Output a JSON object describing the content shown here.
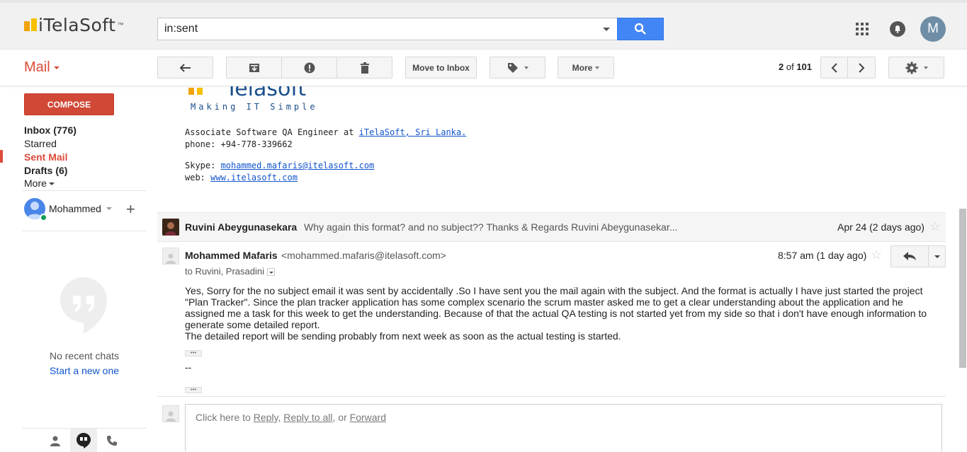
{
  "brand": {
    "name": "iTelaSoft",
    "tm": "™"
  },
  "search": {
    "query": "in:sent"
  },
  "header": {
    "avatar_letter": "M"
  },
  "toolbar": {
    "mail_label": "Mail",
    "move_to_inbox": "Move to Inbox",
    "more": "More",
    "page_current": "2",
    "page_of": "of",
    "page_total": "101"
  },
  "sidebar": {
    "compose": "COMPOSE",
    "items": [
      {
        "label": "Inbox (776)"
      },
      {
        "label": "Starred"
      },
      {
        "label": "Sent Mail"
      },
      {
        "label": "Drafts (6)"
      },
      {
        "label": "More"
      }
    ],
    "user_name": "Mohammed",
    "no_chats": "No recent chats",
    "start_new": "Start a new one"
  },
  "signature": {
    "logo_text": "Telasoft",
    "tagline": "Making IT Simple",
    "role_prefix": "Associate Software QA Engineer at ",
    "role_link": "iTelaSoft, Sri Lanka.",
    "phone": "phone: +94-778-339662",
    "skype_label": "Skype: ",
    "skype_link": "mohammed.mafaris@itelasoft.com",
    "web_label": "web: ",
    "web_link": "www.itelasoft.com"
  },
  "collapsed_message": {
    "sender": "Ruvini Abeygunasekara",
    "snippet": "Why again this format? and no subject?? Thanks & Regards Ruvini Abeygunasekar...",
    "date": "Apr 24 (2 days ago)"
  },
  "message": {
    "from_name": "Mohammed Mafaris",
    "from_email": "<mohammed.mafaris@itelasoft.com>",
    "to": "to Ruvini, Prasadini",
    "time": "8:57 am (1 day ago)",
    "body_p1": "Yes, Sorry for the no subject email it was sent by accidentally .So I have sent you the mail again with the subject. And the format is actually I have just started the project \"Plan Tracker\". Since the plan tracker application has some complex scenario the scrum master asked me to get a clear understanding about the application and he assigned me a task for this week to get the understanding. Because of that the actual QA testing is not started yet from my side so that i don't have enough information to generate some detailed report.",
    "body_p2": "The detailed report will be sending probably from next week as soon as the actual testing is started.",
    "sig_dash": "--"
  },
  "reply": {
    "prefix": "Click here to ",
    "reply": "Reply",
    "comma": ", ",
    "reply_all": "Reply to all",
    "or": ", or ",
    "forward": "Forward"
  },
  "colors": {
    "accent_red": "#dd4b39",
    "search_blue": "#4285f4",
    "link_blue": "#1155cc"
  }
}
